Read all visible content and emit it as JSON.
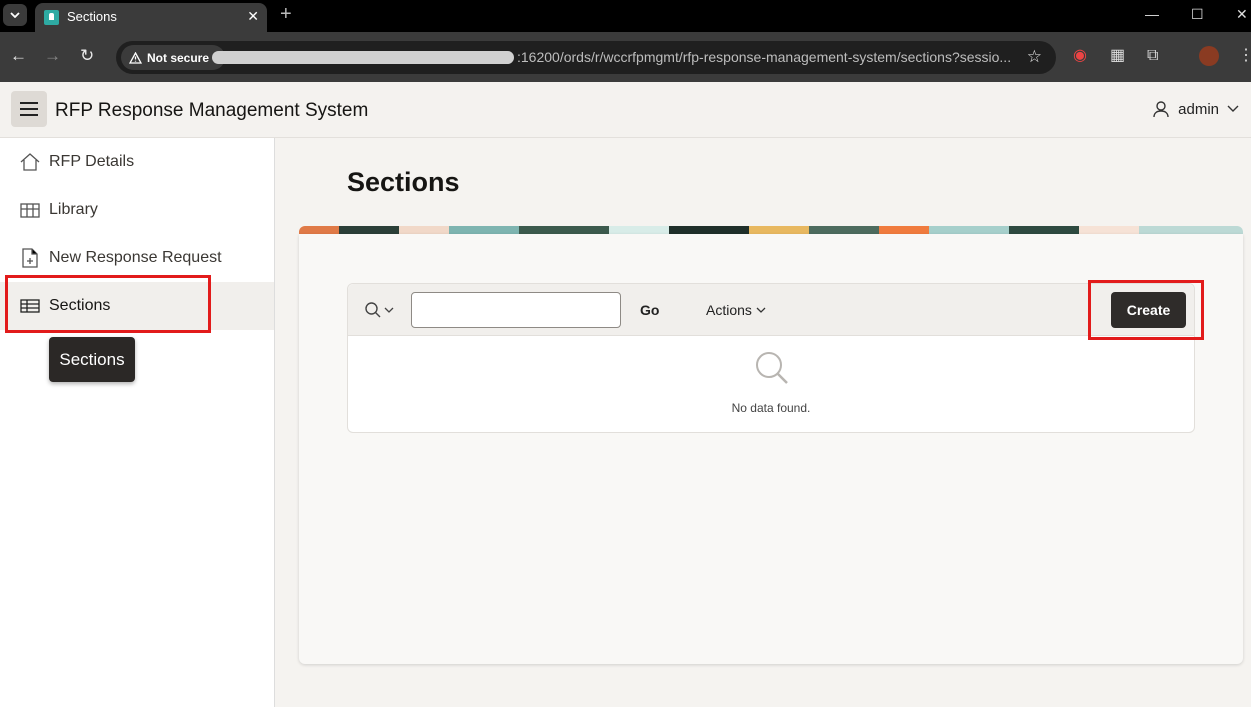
{
  "browser": {
    "tab_title": "Sections",
    "new_tab": "+",
    "security_label": "Not secure",
    "url": ":16200/ords/r/wccrfpmgmt/rfp-response-management-system/sections?sessio..."
  },
  "app": {
    "title": "RFP Response Management System",
    "user": "admin"
  },
  "sidebar": {
    "items": [
      {
        "label": "RFP Details",
        "icon": "home-icon"
      },
      {
        "label": "Library",
        "icon": "grid-icon"
      },
      {
        "label": "New Response Request",
        "icon": "document-add-icon"
      },
      {
        "label": "Sections",
        "icon": "table-icon",
        "active": true
      }
    ],
    "tooltip": "Sections"
  },
  "page": {
    "title": "Sections"
  },
  "report": {
    "search_value": "",
    "go_label": "Go",
    "actions_label": "Actions",
    "create_label": "Create",
    "empty_message": "No data found."
  },
  "colors": {
    "highlight": "#e21b1b",
    "create_button": "#2f2c2a",
    "favicon": "#2eaaa3"
  }
}
